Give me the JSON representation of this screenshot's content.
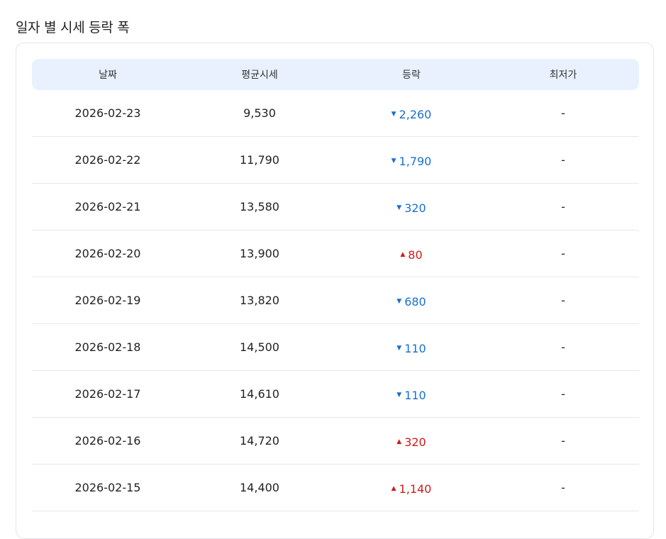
{
  "section": {
    "title": "일자 별 시세 등락 폭"
  },
  "table": {
    "columns": [
      "날짜",
      "평균시세",
      "등락",
      "최저가"
    ],
    "rows": [
      {
        "date": "2026-02-23",
        "avg": "9,530",
        "change": "2,260",
        "dir": "down",
        "low": "-"
      },
      {
        "date": "2026-02-22",
        "avg": "11,790",
        "change": "1,790",
        "dir": "down",
        "low": "-"
      },
      {
        "date": "2026-02-21",
        "avg": "13,580",
        "change": "320",
        "dir": "down",
        "low": "-"
      },
      {
        "date": "2026-02-20",
        "avg": "13,900",
        "change": "80",
        "dir": "up",
        "low": "-"
      },
      {
        "date": "2026-02-19",
        "avg": "13,820",
        "change": "680",
        "dir": "down",
        "low": "-"
      },
      {
        "date": "2026-02-18",
        "avg": "14,500",
        "change": "110",
        "dir": "down",
        "low": "-"
      },
      {
        "date": "2026-02-17",
        "avg": "14,610",
        "change": "110",
        "dir": "down",
        "low": "-"
      },
      {
        "date": "2026-02-16",
        "avg": "14,720",
        "change": "320",
        "dir": "up",
        "low": "-"
      },
      {
        "date": "2026-02-15",
        "avg": "14,400",
        "change": "1,140",
        "dir": "up",
        "low": "-"
      }
    ]
  },
  "icons": {
    "down": "triangle-down-icon",
    "up": "triangle-up-icon"
  },
  "colors": {
    "down": "#1a6fd1",
    "up": "#d11a1a",
    "header_bg": "#e8f1fd"
  }
}
